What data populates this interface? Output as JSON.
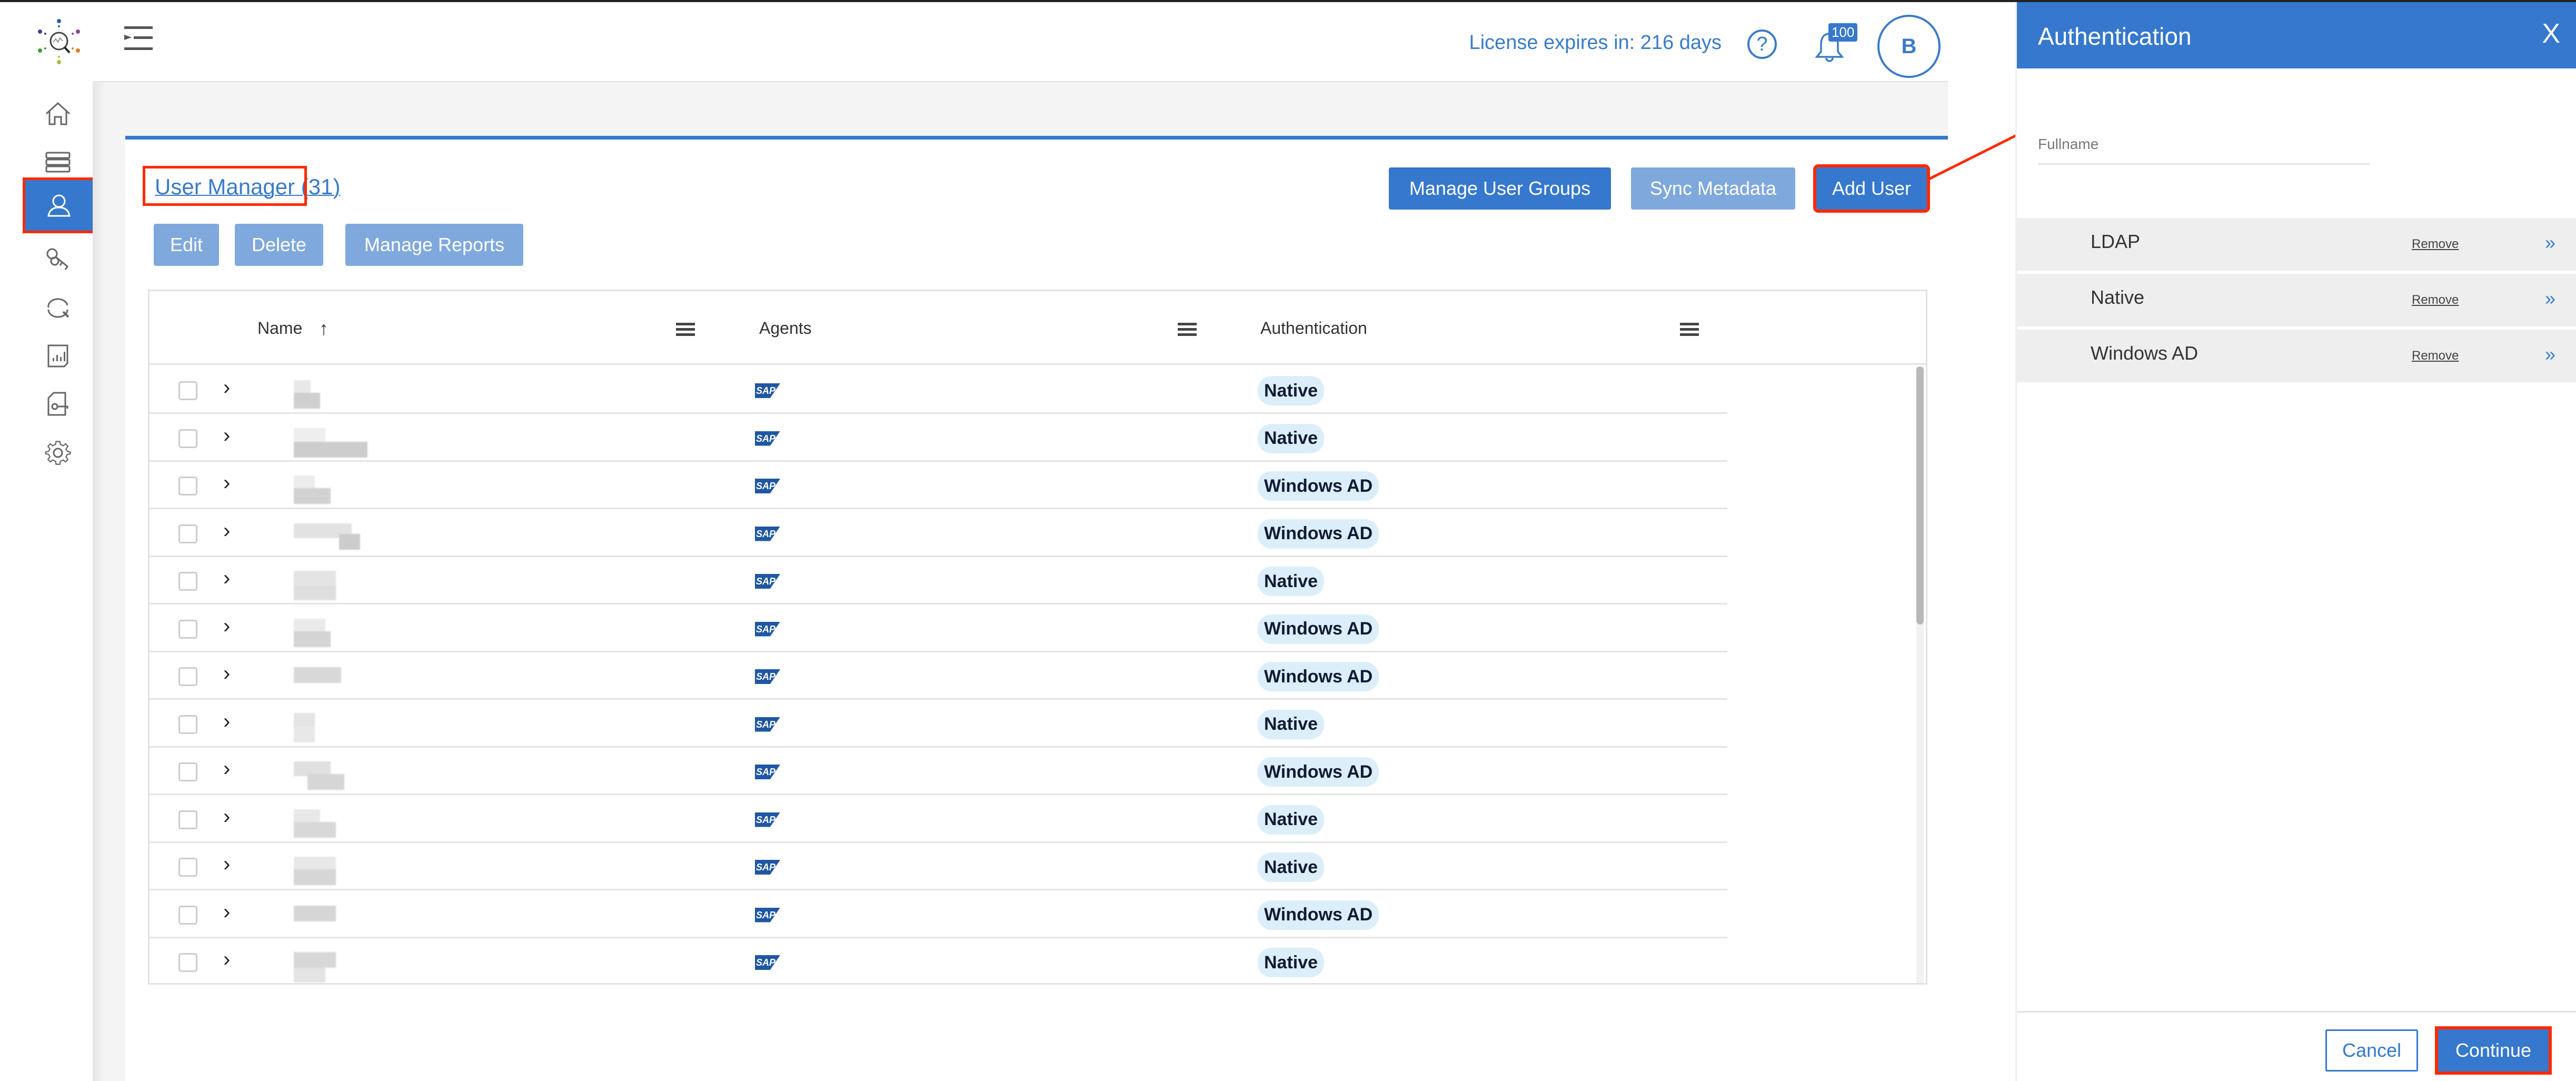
{
  "header": {
    "license_text": "License expires in: 216 days",
    "help_label": "?",
    "notification_count": "100",
    "avatar_initial": "B"
  },
  "sidebar": {
    "items": [
      {
        "name": "home",
        "icon": "home-icon"
      },
      {
        "name": "data-sources",
        "icon": "server-icon"
      },
      {
        "name": "user-manager",
        "icon": "user-icon",
        "active": true
      },
      {
        "name": "keys",
        "icon": "keys-icon"
      },
      {
        "name": "scan",
        "icon": "scan-refresh-icon"
      },
      {
        "name": "reports",
        "icon": "report-icon"
      },
      {
        "name": "policies",
        "icon": "document-key-icon"
      },
      {
        "name": "settings",
        "icon": "gear-icon"
      }
    ]
  },
  "page": {
    "title": "User Manager",
    "count": "(31)",
    "buttons": {
      "edit": "Edit",
      "delete": "Delete",
      "manage_reports": "Manage Reports",
      "manage_user_groups": "Manage User Groups",
      "sync_metadata": "Sync Metadata",
      "add_user": "Add User"
    }
  },
  "table": {
    "columns": {
      "name": "Name",
      "agents": "Agents",
      "authentication": "Authentication"
    },
    "sort_indicator": "↑",
    "agent_label": "SAP",
    "rows": [
      {
        "name": "[redacted]",
        "agent": "SAP",
        "auth": "Native"
      },
      {
        "name": "[redacted]",
        "agent": "SAP",
        "auth": "Native"
      },
      {
        "name": "[redacted]",
        "agent": "SAP",
        "auth": "Windows AD"
      },
      {
        "name": "[redacted]",
        "agent": "SAP",
        "auth": "Windows AD"
      },
      {
        "name": "[redacted]",
        "agent": "SAP",
        "auth": "Native"
      },
      {
        "name": "[redacted]",
        "agent": "SAP",
        "auth": "Windows AD"
      },
      {
        "name": "[redacted]",
        "agent": "SAP",
        "auth": "Windows AD"
      },
      {
        "name": "[redacted]",
        "agent": "SAP",
        "auth": "Native"
      },
      {
        "name": "[redacted]",
        "agent": "SAP",
        "auth": "Windows AD"
      },
      {
        "name": "[redacted]",
        "agent": "SAP",
        "auth": "Native"
      },
      {
        "name": "[redacted]",
        "agent": "SAP",
        "auth": "Native"
      },
      {
        "name": "[redacted]",
        "agent": "SAP",
        "auth": "Windows AD"
      },
      {
        "name": "[redacted]",
        "agent": "SAP",
        "auth": "Native"
      }
    ]
  },
  "panel": {
    "title": "Authentication",
    "close_label": "X",
    "fullname_placeholder": "Fullname",
    "auth_methods": [
      {
        "name": "LDAP",
        "remove": "Remove",
        "chevron": "»"
      },
      {
        "name": "Native",
        "remove": "Remove",
        "chevron": "»"
      },
      {
        "name": "Windows AD",
        "remove": "Remove",
        "chevron": "»"
      }
    ],
    "cancel": "Cancel",
    "continue": "Continue"
  },
  "colors": {
    "primary": "#3578cd",
    "primary_disabled": "#7fa8dd",
    "badge_bg": "#dbeefa",
    "highlight": "#ff2a00"
  }
}
